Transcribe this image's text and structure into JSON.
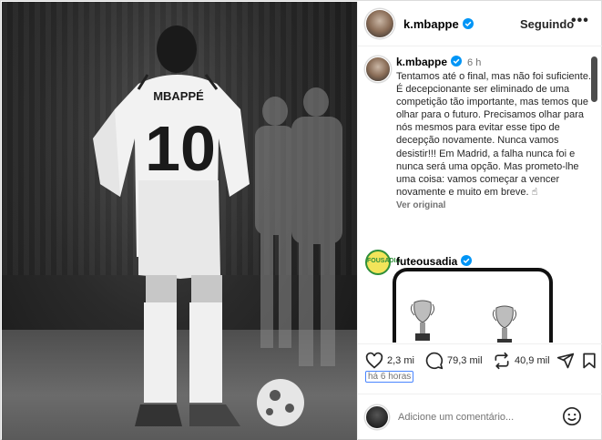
{
  "post": {
    "username": "k.mbappe",
    "follow_label": "Seguindo",
    "more_label": "•••",
    "colors": {
      "verified": "#0095f6",
      "link": "#737373"
    }
  },
  "caption": {
    "username": "k.mbappe",
    "time": "6 h",
    "text": "Tentamos até o final, mas não foi suficiente. É decepcionante ser eliminado de uma competição tão importante, mas temos que olhar para o futuro. Precisamos olhar para nós mesmos para evitar esse tipo de decepção novamente. Nunca vamos desistir!!! Em Madrid, a falha nunca foi e nunca será uma opção. Mas prometo-lhe uma coisa: vamos começar a vencer novamente e muito em breve. ☝",
    "see_original": "Ver original"
  },
  "comment": {
    "username": "futeousadia",
    "avatar_text": "FOUSADIA"
  },
  "actions": {
    "likes": "2,3 mi",
    "comments": "79,3 mil",
    "reposts": "40,9 mil",
    "icons": [
      "heart-icon",
      "comment-icon",
      "repost-icon",
      "share-icon",
      "bookmark-icon"
    ]
  },
  "timestamp": "há 6 horas",
  "add_comment": {
    "placeholder": "Adicione um comentário..."
  }
}
